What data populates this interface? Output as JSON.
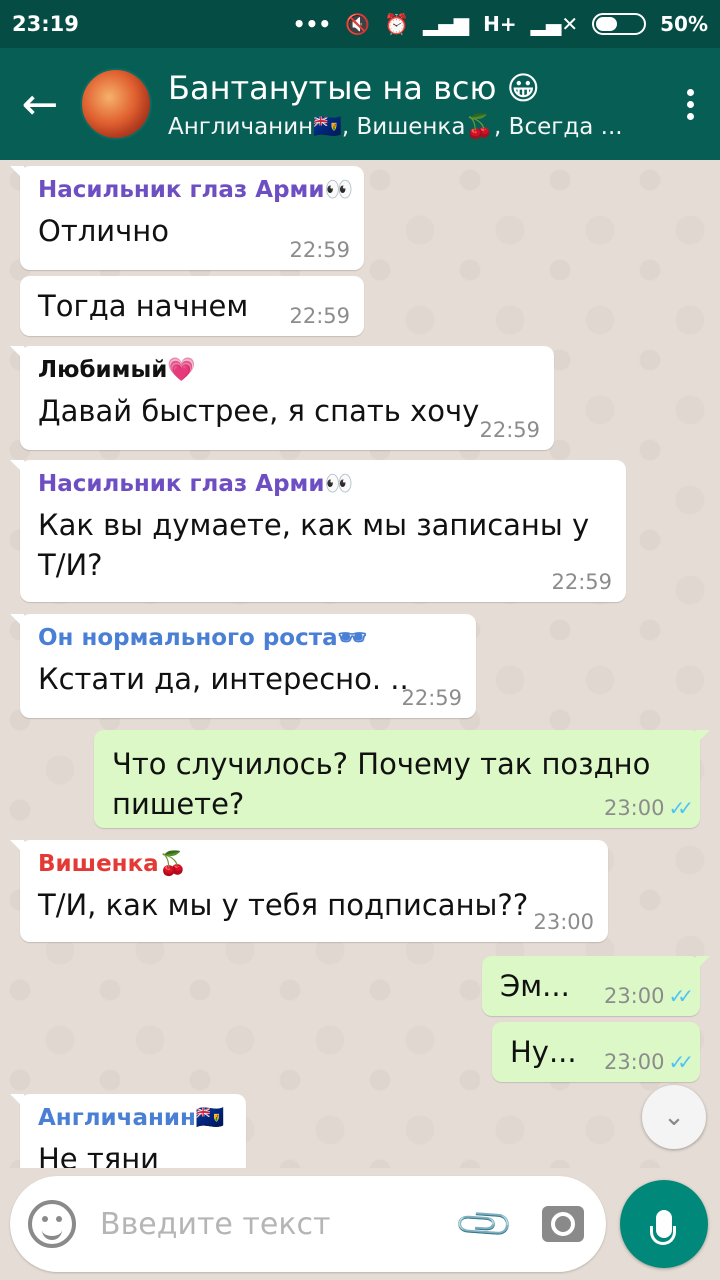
{
  "status_bar": {
    "time": "23:19",
    "network": "H+",
    "battery": "50%",
    "battery_level": 0.5
  },
  "header": {
    "title": "Бантанутые на всю 😀",
    "subtitle": "Англичанин🇹🇨, Вишенка🍒, Всегда ..."
  },
  "messages": [
    {
      "sender": "Насильник глаз Арми👀",
      "sender_color": "#6e4fc3",
      "text": "Отлично",
      "time": "22:59"
    },
    {
      "sender": "",
      "text": "Тогда начнем",
      "time": "22:59"
    },
    {
      "sender": "Любимый💗",
      "sender_color": "#111111",
      "text": "Давай быстрее, я спать хочу",
      "time": "22:59"
    },
    {
      "sender": "Насильник глаз Арми👀",
      "sender_color": "#6e4fc3",
      "text": "Как вы думаете, как мы записаны у Т/И?",
      "time": "22:59"
    },
    {
      "sender": "Он нормального роста🕶",
      "sender_color": "#4a7fd6",
      "text": "Кстати да, интересно. ..",
      "time": "22:59"
    },
    {
      "sender": "",
      "text": "Что случилось? Почему так поздно пишете?",
      "time": "23:00",
      "ticks": "✓✓"
    },
    {
      "sender": "Вишенка🍒",
      "sender_color": "#e53935",
      "text": "Т/И, как мы у тебя подписаны??",
      "time": "23:00"
    },
    {
      "sender": "",
      "text": "Эм...",
      "time": "23:00",
      "ticks": "✓✓"
    },
    {
      "sender": "",
      "text": "Ну...",
      "time": "23:00",
      "ticks": "✓✓"
    },
    {
      "sender": "Англичанин🇹🇨",
      "sender_color": "#4a7fd6",
      "text": "Не тяни",
      "time": ""
    }
  ],
  "composer": {
    "placeholder": "Введите текст"
  }
}
